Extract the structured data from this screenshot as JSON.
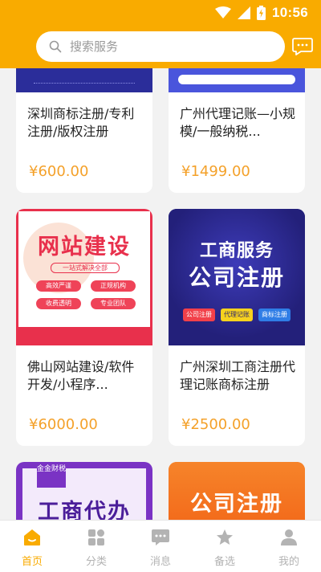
{
  "status": {
    "time": "10:56"
  },
  "search": {
    "placeholder": "搜索服务"
  },
  "products": [
    {
      "title": "深圳商标注册/专利注册/版权注册",
      "price": "¥600.00"
    },
    {
      "title": "广州代理记账—小规模/一般纳税...",
      "price": "¥1499.00"
    },
    {
      "title": "佛山网站建设/软件开发/小程序...",
      "price": "¥6000.00",
      "image": {
        "heading": "网站建设",
        "subtitle": "一站式解决全部",
        "tags": [
          "高效严谨",
          "正规机构",
          "收费透明",
          "专业团队"
        ]
      }
    },
    {
      "title": "广州深圳工商注册代理记账商标注册",
      "price": "¥2500.00",
      "image": {
        "heading1": "工商服务",
        "heading2": "公司注册",
        "tags": [
          "公司注册",
          "代理记账",
          "商标注册"
        ]
      }
    },
    {
      "title": "",
      "price": "",
      "image": {
        "badge": "金金财税",
        "heading": "工商代办"
      }
    },
    {
      "title": "",
      "price": "",
      "image": {
        "heading": "公司注册"
      }
    }
  ],
  "tabbar": [
    {
      "label": "首页",
      "icon": "home-icon",
      "active": true
    },
    {
      "label": "分类",
      "icon": "category-icon"
    },
    {
      "label": "消息",
      "icon": "message-icon"
    },
    {
      "label": "备选",
      "icon": "star-icon"
    },
    {
      "label": "我的",
      "icon": "user-icon"
    }
  ],
  "colors": {
    "accent": "#f9ab00",
    "price": "#f4a12a",
    "inactive": "#b3b3b3"
  }
}
